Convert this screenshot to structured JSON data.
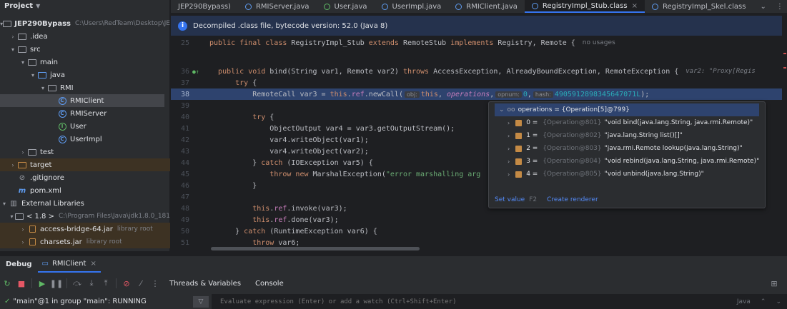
{
  "project": {
    "title": "Project",
    "tree": [
      {
        "label": "JEP290Bypass",
        "detail": "C:\\Users\\RedTeam\\Desktop\\JE",
        "icon": "folder-icon",
        "bold": true
      },
      {
        "label": ".idea",
        "icon": "folder-icon"
      },
      {
        "label": "src",
        "icon": "folder-icon"
      },
      {
        "label": "main",
        "icon": "folder-icon"
      },
      {
        "label": "java",
        "icon": "source-folder-icon"
      },
      {
        "label": "RMI",
        "icon": "package-icon"
      },
      {
        "label": "RMIClient",
        "icon": "class-icon"
      },
      {
        "label": "RMIServer",
        "icon": "class-icon"
      },
      {
        "label": "User",
        "icon": "interface-icon"
      },
      {
        "label": "UserImpl",
        "icon": "class-icon"
      },
      {
        "label": "test",
        "icon": "folder-icon"
      },
      {
        "label": "target",
        "icon": "excluded-folder-icon"
      },
      {
        "label": ".gitignore",
        "icon": "gitignore-icon"
      },
      {
        "label": "pom.xml",
        "icon": "maven-icon"
      },
      {
        "label": "External Libraries",
        "icon": "library-icon"
      },
      {
        "label": "< 1.8 >",
        "detail": "C:\\Program Files\\Java\\jdk1.8.0_181",
        "icon": "jdk-icon"
      },
      {
        "label": "access-bridge-64.jar",
        "detail": "library root",
        "icon": "jar-icon"
      },
      {
        "label": "charsets.jar",
        "detail": "library root",
        "icon": "jar-icon"
      }
    ]
  },
  "tabs": [
    {
      "label": "JEP290Bypass)"
    },
    {
      "label": "RMIServer.java"
    },
    {
      "label": "User.java"
    },
    {
      "label": "UserImpl.java"
    },
    {
      "label": "RMIClient.java"
    },
    {
      "label": "RegistryImpl_Stub.class",
      "active": true
    },
    {
      "label": "RegistryImpl_Skel.class"
    }
  ],
  "banner": {
    "text": "Decompiled .class file, bytecode version: 52.0 (Java 8)"
  },
  "editor": {
    "lines": {
      "l25": {
        "num": "25",
        "kw1": "public final class ",
        "name": "RegistryImpl_Stub ",
        "kw2": "extends ",
        "t2": "RemoteStub ",
        "kw3": "implements ",
        "t3": "Registry, Remote {",
        "hint": "no usages"
      },
      "l36": {
        "num": "36",
        "kw1": "public void ",
        "t1": "bind(String var1, Remote var2) ",
        "kw2": "throws ",
        "t2": "AccessException, AlreadyBoundException, RemoteException {",
        "hint": "var2: \"Proxy[Regis"
      },
      "l37": {
        "num": "37",
        "kw1": "try",
        "t1": " {"
      },
      "l38": {
        "num": "38",
        "t1": "RemoteCall var3 = ",
        "kw1": "this",
        "t2": ".",
        "f1": "ref",
        "t3": ".newCall(",
        "inlay1": "obj:",
        "kw2": "this",
        "t4": ", ",
        "f2": "operations",
        "t5": ",",
        "inlay2": "opnum:",
        "n1": "0",
        "t6": ",",
        "inlay3": "hash:",
        "n2": "4905912898345647071L",
        "t7": ");"
      },
      "l39": {
        "num": "39"
      },
      "l40": {
        "num": "40",
        "kw1": "try",
        "t1": " {"
      },
      "l41": {
        "num": "41",
        "t1": "ObjectOutput var4 = var3.getOutputStream();"
      },
      "l42": {
        "num": "42",
        "t1": "var4.writeObject(var1);"
      },
      "l43": {
        "num": "43",
        "t1": "var4.writeObject(var2);"
      },
      "l44": {
        "num": "44",
        "t1": "} ",
        "kw1": "catch",
        "t2": " (IOException var5) {"
      },
      "l45": {
        "num": "45",
        "kw1": "throw new ",
        "t1": "MarshalException(",
        "s1": "\"error marshalling arg"
      },
      "l46": {
        "num": "46",
        "t1": "}"
      },
      "l47": {
        "num": "47"
      },
      "l48": {
        "num": "48",
        "kw1": "this",
        "t1": ".",
        "f1": "ref",
        "t2": ".invoke(var3);"
      },
      "l49": {
        "num": "49",
        "kw1": "this",
        "t1": ".",
        "f1": "ref",
        "t2": ".done(var3);"
      },
      "l50": {
        "num": "50",
        "t1": "} ",
        "kw1": "catch",
        "t2": " (RuntimeException var6) {"
      },
      "l51": {
        "num": "51",
        "kw1": "throw ",
        "t1": "var6;"
      }
    }
  },
  "popup": {
    "header": "operations = {Operation[5]@799}",
    "items": [
      {
        "index": "0",
        "ref": "{Operation@801}",
        "value": "\"void bind(java.lang.String, java.rmi.Remote)\""
      },
      {
        "index": "1",
        "ref": "{Operation@802}",
        "value": "\"java.lang.String list()[]\""
      },
      {
        "index": "2",
        "ref": "{Operation@803}",
        "value": "\"java.rmi.Remote lookup(java.lang.String)\""
      },
      {
        "index": "3",
        "ref": "{Operation@804}",
        "value": "\"void rebind(java.lang.String, java.rmi.Remote)\""
      },
      {
        "index": "4",
        "ref": "{Operation@805}",
        "value": "\"void unbind(java.lang.String)\""
      }
    ],
    "set_value": "Set value",
    "set_value_key": "F2",
    "create_renderer": "Create renderer"
  },
  "debug": {
    "title": "Debug",
    "session_tab": "RMIClient",
    "tab_threads": "Threads & Variables",
    "tab_console": "Console",
    "thread": "\"main\"@1 in group \"main\": RUNNING",
    "eval_placeholder": "Evaluate expression (Enter) or add a watch (Ctrl+Shift+Enter)",
    "lang": "Java"
  },
  "colors": {
    "background": "#1e1f22",
    "panel": "#2b2d30",
    "accent": "#3574f0",
    "execution_line": "#2e436e"
  }
}
